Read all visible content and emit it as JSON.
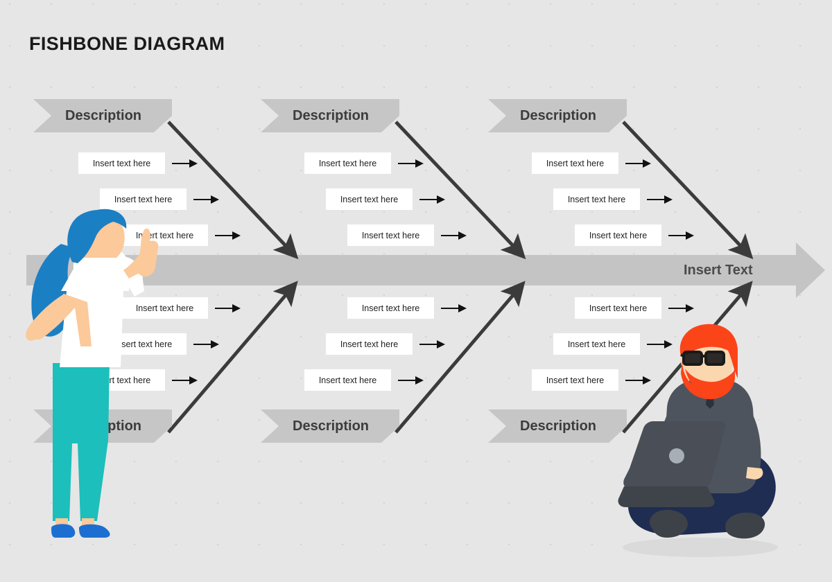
{
  "title": "FISHBONE DIAGRAM",
  "colors": {
    "background": "#e6e6e6",
    "dot_grid": "#d2d2d2",
    "banner_fill": "#c6c6c6",
    "banner_text": "#3c3c3c",
    "spine_fill": "#c4c4c4",
    "spine_text": "#4a4a4a",
    "bone_line": "#3b3b3b",
    "box_fill": "#ffffff",
    "box_text": "#1e1e1e",
    "arrow": "#111111",
    "title_text": "#1a1a1a"
  },
  "spine": {
    "label": "Insert Text"
  },
  "categories": [
    {
      "id": "top-1",
      "position": "top",
      "banner_label": "Description",
      "banner_occluded": false,
      "items": [
        {
          "label": "Insert text here"
        },
        {
          "label": "Insert text here"
        },
        {
          "label": "Insert text here"
        }
      ]
    },
    {
      "id": "top-2",
      "position": "top",
      "banner_label": "Description",
      "banner_occluded": false,
      "items": [
        {
          "label": "Insert text here"
        },
        {
          "label": "Insert text here"
        },
        {
          "label": "Insert text here"
        }
      ]
    },
    {
      "id": "top-3",
      "position": "top",
      "banner_label": "Description",
      "banner_occluded": false,
      "items": [
        {
          "label": "Insert text here"
        },
        {
          "label": "Insert text here"
        },
        {
          "label": "Insert text here"
        }
      ]
    },
    {
      "id": "bottom-1",
      "position": "bottom",
      "banner_label": "Description",
      "banner_occluded": true,
      "items": [
        {
          "label": "Insert text here"
        },
        {
          "label": "Insert text here"
        },
        {
          "label": "Insert text here"
        }
      ]
    },
    {
      "id": "bottom-2",
      "position": "bottom",
      "banner_label": "Description",
      "banner_occluded": false,
      "items": [
        {
          "label": "Insert text here"
        },
        {
          "label": "Insert text here"
        },
        {
          "label": "Insert text here"
        }
      ]
    },
    {
      "id": "bottom-3",
      "position": "bottom",
      "banner_label": "Description",
      "banner_occluded": false,
      "items": [
        {
          "label": "Insert text here"
        },
        {
          "label": "Insert text here"
        },
        {
          "label": "Insert text here"
        }
      ]
    }
  ],
  "illustrations": [
    {
      "name": "woman-pointing",
      "hair": "#1b7fc4",
      "skin": "#fbc99a",
      "top": "#ffffff",
      "pants": "#1cbfbb",
      "shoes": "#1c6fd0"
    },
    {
      "name": "man-with-laptop",
      "hair": "#fc4419",
      "skin": "#fbd7b0",
      "sweater": "#4e545e",
      "pants": "#1f2d52",
      "laptop": "#4a4f57",
      "shoes": "#3d4148",
      "glasses": "#1a1a1a"
    }
  ]
}
